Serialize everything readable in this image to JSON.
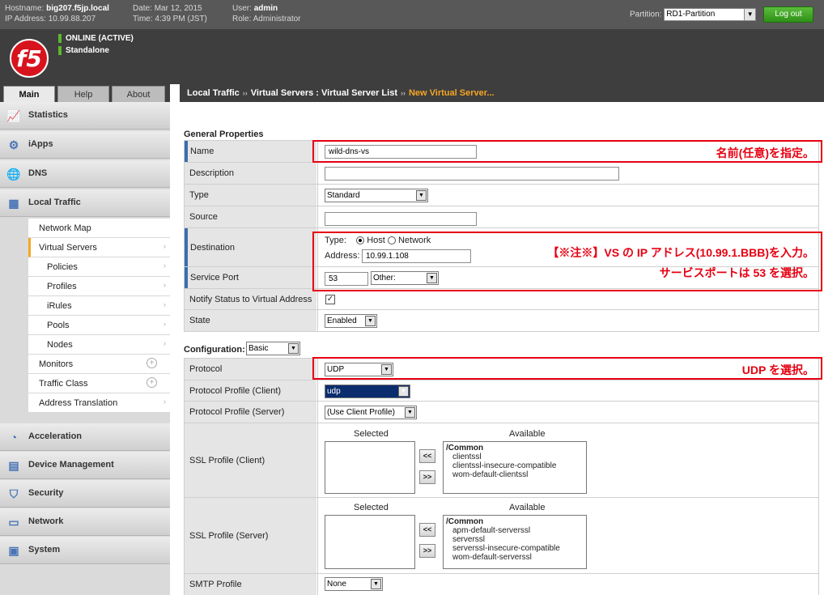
{
  "header": {
    "hostname_label": "Hostname:",
    "hostname": "big207.f5jp.local",
    "ip_label": "IP Address:",
    "ip": "10.99.88.207",
    "date_label": "Date:",
    "date": "Mar 12, 2015",
    "time_label": "Time:",
    "time": "4:39 PM (JST)",
    "user_label": "User:",
    "user": "admin",
    "role_label": "Role:",
    "role": "Administrator",
    "partition_label": "Partition:",
    "partition_value": "RD1-Partition",
    "logout": "Log out"
  },
  "status": {
    "line1": "ONLINE (ACTIVE)",
    "line2": "Standalone"
  },
  "logo": "f5",
  "tabs": {
    "main": "Main",
    "help": "Help",
    "about": "About"
  },
  "nav": {
    "statistics": "Statistics",
    "iapps": "iApps",
    "dns": "DNS",
    "local_traffic": "Local Traffic",
    "lt_items": [
      "Network Map",
      "Virtual Servers",
      "Policies",
      "Profiles",
      "iRules",
      "Pools",
      "Nodes",
      "Monitors",
      "Traffic Class",
      "Address Translation"
    ],
    "acceleration": "Acceleration",
    "device_management": "Device Management",
    "security": "Security",
    "network": "Network",
    "system": "System"
  },
  "breadcrumb": {
    "a": "Local Traffic",
    "b": "Virtual Servers : Virtual Server List",
    "c": "New Virtual Server...",
    "sep": "››"
  },
  "form": {
    "general_title": "General Properties",
    "name_label": "Name",
    "name_value": "wild-dns-vs",
    "description_label": "Description",
    "description_value": "",
    "type_label": "Type",
    "type_value": "Standard",
    "source_label": "Source",
    "source_value": "",
    "destination_label": "Destination",
    "dest_type_label": "Type:",
    "dest_host": "Host",
    "dest_network": "Network",
    "dest_address_label": "Address:",
    "dest_address": "10.99.1.108",
    "service_port_label": "Service Port",
    "service_port": "53",
    "service_port_select": "Other:",
    "notify_label": "Notify Status to Virtual Address",
    "notify_mark": "✓",
    "state_label": "State",
    "state_value": "Enabled",
    "config_label": "Configuration:",
    "config_value": "Basic",
    "protocol_label": "Protocol",
    "protocol_value": "UDP",
    "pp_client_label": "Protocol Profile (Client)",
    "pp_client_value": "udp",
    "pp_server_label": "Protocol Profile (Server)",
    "pp_server_value": "(Use Client Profile)",
    "ssl_client_label": "SSL Profile (Client)",
    "ssl_server_label": "SSL Profile (Server)",
    "selected_head": "Selected",
    "available_head": "Available",
    "move_left": "<<",
    "move_right": ">>",
    "ssl_client_available": {
      "group": "/Common",
      "items": [
        "clientssl",
        "clientssl-insecure-compatible",
        "wom-default-clientssl"
      ]
    },
    "ssl_server_available": {
      "group": "/Common",
      "items": [
        "apm-default-serverssl",
        "serverssl",
        "serverssl-insecure-compatible",
        "wom-default-serverssl"
      ]
    },
    "smtp_label": "SMTP Profile",
    "smtp_value": "None"
  },
  "annotations": {
    "name": "名前(任意)を指定。",
    "dest_line1": "【※注※】VS の IP アドレス(10.99.1.BBB)を入力。",
    "dest_line2": "サービスポートは 53 を選択。",
    "protocol": "UDP を選択。"
  },
  "colors": {
    "annotation": "#e60012",
    "accent_orange": "#f5a623",
    "logout_green": "#3aa322",
    "f5_red": "#d7141d"
  }
}
